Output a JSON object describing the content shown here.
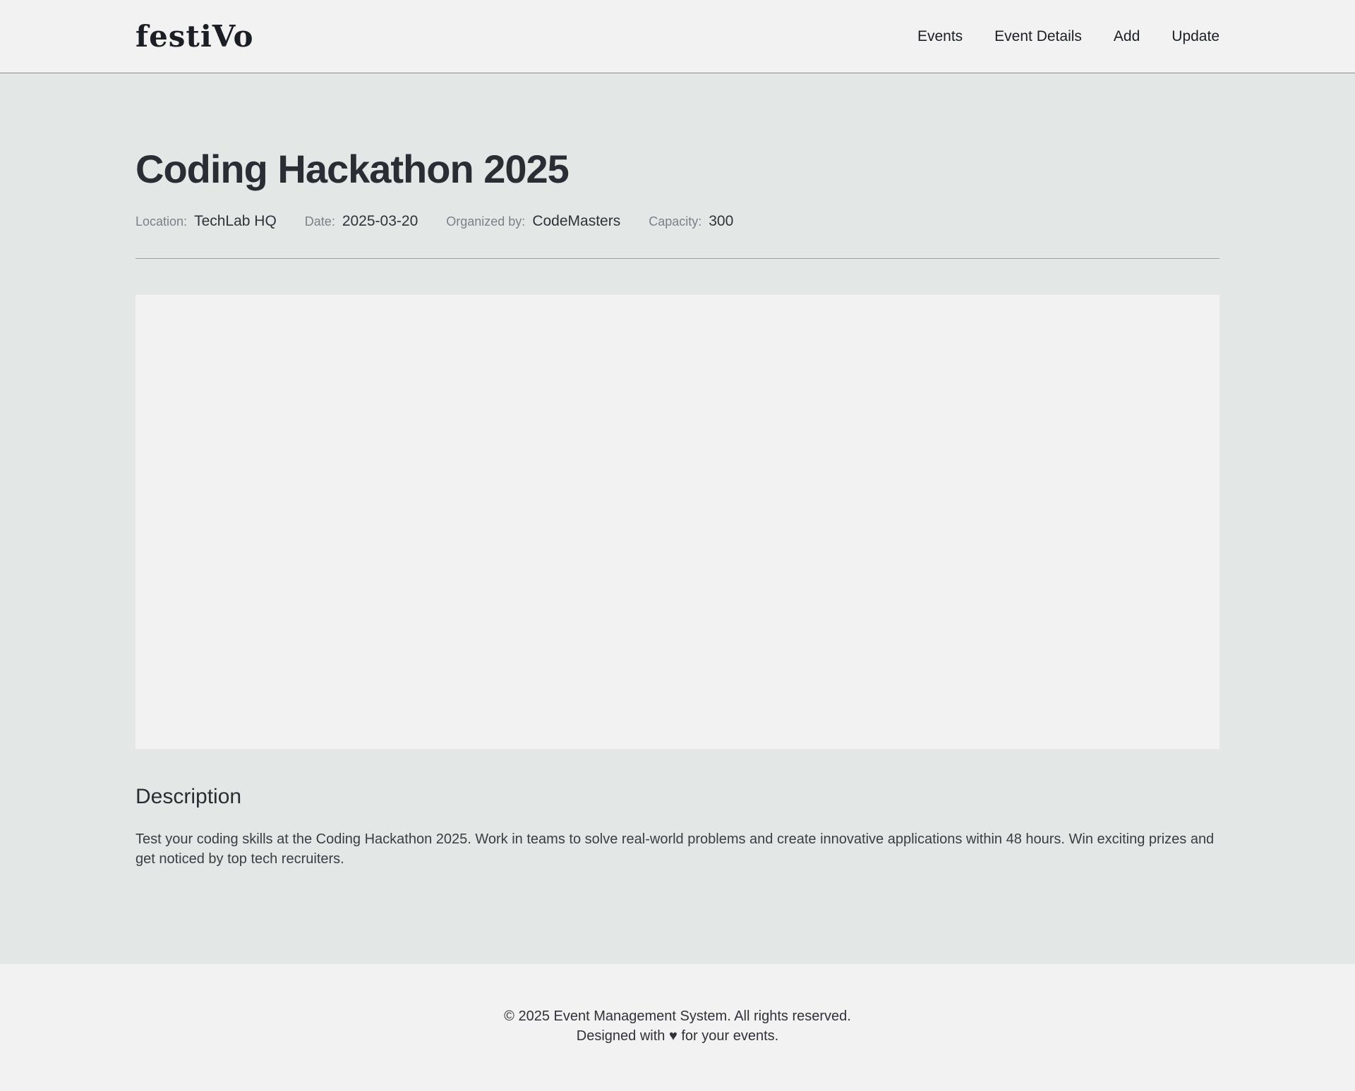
{
  "brand": {
    "logo": "festiVo"
  },
  "nav": {
    "items": [
      {
        "label": "Events"
      },
      {
        "label": "Event Details"
      },
      {
        "label": "Add"
      },
      {
        "label": "Update"
      }
    ]
  },
  "event": {
    "title": "Coding Hackathon 2025",
    "meta": [
      {
        "label": "Location:",
        "value": "TechLab HQ"
      },
      {
        "label": "Date:",
        "value": "2025-03-20"
      },
      {
        "label": "Organized by:",
        "value": "CodeMasters"
      },
      {
        "label": "Capacity:",
        "value": "300"
      }
    ],
    "description_heading": "Description",
    "description": "Test your coding skills at the Coding Hackathon 2025. Work in teams to solve real-world problems and create innovative applications within 48 hours. Win exciting prizes and get noticed by top tech recruiters."
  },
  "footer": {
    "copyright": "© 2025 Event Management System. All rights reserved.",
    "tagline": "Designed with ♥ for your events."
  },
  "colors": {
    "page_bg": "#e3e7e6",
    "header_bg": "#f2f2f2",
    "text": "#2a2d33",
    "muted": "#7c8088"
  }
}
